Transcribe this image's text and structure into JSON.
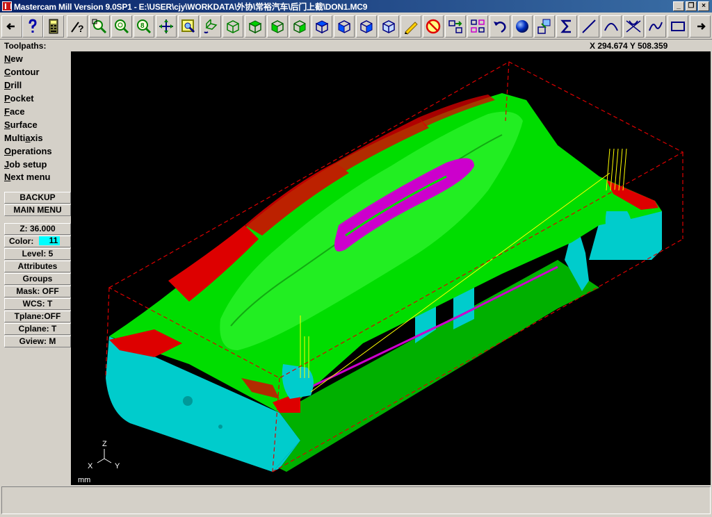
{
  "window": {
    "title": "Mastercam Mill Version 9.0SP1 - E:\\USER\\cjy\\WORKDATA\\外协\\常裕汽车\\后门上截\\DON1.MC9",
    "minimize": "_",
    "restore": "❐",
    "close": "×"
  },
  "toolbar": {
    "icons": [
      "back-arrow-icon",
      "help-icon",
      "calculator-icon",
      "analyze-icon",
      "zoom-window-icon",
      "zoom-in-icon",
      "zoom-out-icon",
      "pan-icon",
      "select-icon",
      "rotate-icon",
      "view-top-icon",
      "view-front-icon",
      "view-side-icon",
      "view-iso-icon",
      "cube-blue-1-icon",
      "cube-blue-2-icon",
      "cube-blue-3-icon",
      "cube-blue-4-icon",
      "pencil-icon",
      "no-entry-icon",
      "transform-icon",
      "group-icon",
      "undo-icon",
      "shade-sphere-icon",
      "xform-move-icon",
      "sum-icon",
      "line-icon",
      "arc-icon",
      "fillet-icon",
      "spline-icon",
      "rectangle-icon",
      "forward-arrow-icon"
    ],
    "accent_green": "#00b000",
    "accent_blue": "#0000ff"
  },
  "info": {
    "section_label": "Toolpaths:",
    "coordinates": "X 294.674  Y 508.359"
  },
  "menu": {
    "items": [
      {
        "u": "N",
        "rest": "ew"
      },
      {
        "u": "C",
        "rest": "ontour"
      },
      {
        "u": "D",
        "rest": "rill"
      },
      {
        "u": "P",
        "rest": "ocket"
      },
      {
        "u": "F",
        "rest": "ace"
      },
      {
        "u": "S",
        "rest": "urface"
      },
      {
        "pre": "Multi",
        "u": "a",
        "rest": "xis"
      },
      {
        "u": "O",
        "rest": "perations"
      },
      {
        "u": "J",
        "rest": "ob setup"
      },
      {
        "u": "N",
        "rest": "ext menu"
      }
    ],
    "backup": "BACKUP",
    "main_menu": "MAIN MENU"
  },
  "settings": {
    "z": "Z:  36.000",
    "color_label": "Color:",
    "color_value": "11",
    "level": "Level:  5",
    "attributes": "Attributes",
    "groups": "Groups",
    "mask": "Mask:  OFF",
    "wcs": "WCS:   T",
    "tplane": "Tplane:OFF",
    "cplane": "Cplane:  T",
    "gview": "Gview:   M"
  },
  "viewport": {
    "background": "#000000",
    "axis_z": "Z",
    "axis_x": "X",
    "axis_y": "Y",
    "units": "mm",
    "colors": {
      "green": "#00dd00",
      "red": "#dd0000",
      "cyan": "#00cccc",
      "magenta": "#cc00cc",
      "yellow": "#ffff00"
    }
  },
  "status": {
    "message": ""
  }
}
